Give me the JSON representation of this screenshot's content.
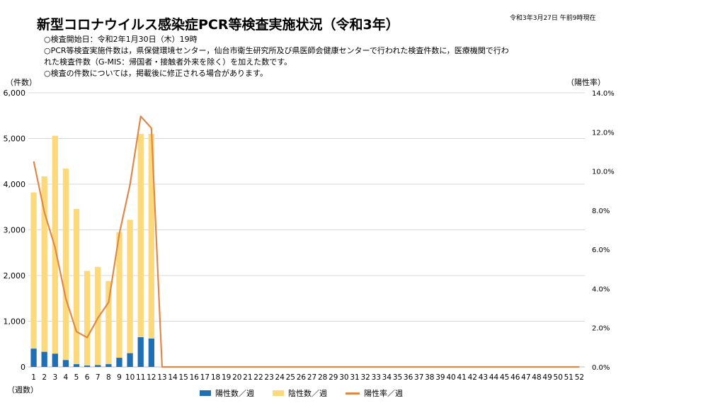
{
  "title": "新型コロナウイルス感染症PCR等検査実施状況（令和3年）",
  "as_of": "令和3年3月27日 午前9時現在",
  "notes": [
    "○検査開始日：令和2年1月30日（木）19時",
    "○PCR等検査実施件数は，県保健環境センター，仙台市衛生研究所及び県医師会健康センターで行われた検査件数に，医療機関で行わ",
    "れた検査件数（G-MIS：帰国者・接触者外来を除く）を加えた数です。",
    "○検査の件数については，掲載後に修正される場合があります。"
  ],
  "colors": {
    "positive": "#1f6fb5",
    "negative": "#fcd97a",
    "rate": "#e08848"
  },
  "chart_data": {
    "type": "bar",
    "ylabel": "（件数）",
    "y2label": "（陽性率）",
    "xlabel": "（週数）",
    "ylim": [
      0,
      6000
    ],
    "y2lim": [
      0,
      14
    ],
    "yticks": [
      "0",
      "1,000",
      "2,000",
      "3,000",
      "4,000",
      "5,000",
      "6,000"
    ],
    "y2ticks": [
      "0.0%",
      "2.0%",
      "4.0%",
      "6.0%",
      "8.0%",
      "10.0%",
      "12.0%",
      "14.0%"
    ],
    "categories": [
      "1",
      "2",
      "3",
      "4",
      "5",
      "6",
      "7",
      "8",
      "9",
      "10",
      "11",
      "12",
      "13",
      "14",
      "15",
      "16",
      "17",
      "18",
      "19",
      "20",
      "21",
      "22",
      "23",
      "24",
      "25",
      "26",
      "27",
      "28",
      "29",
      "30",
      "31",
      "32",
      "33",
      "34",
      "35",
      "36",
      "37",
      "38",
      "39",
      "40",
      "41",
      "42",
      "43",
      "44",
      "45",
      "46",
      "47",
      "48",
      "49",
      "50",
      "51",
      "52"
    ],
    "series": [
      {
        "name": "陽性数／週",
        "kind": "bar-stack",
        "values": [
          400,
          330,
          290,
          150,
          60,
          30,
          40,
          60,
          200,
          300,
          650,
          620
        ]
      },
      {
        "name": "陰性数／週",
        "kind": "bar-stack",
        "values": [
          3420,
          3840,
          4770,
          4190,
          3400,
          2070,
          2150,
          1820,
          2750,
          2920,
          4450,
          4480
        ]
      },
      {
        "name": "陽性率／週",
        "kind": "line-secondary",
        "values": [
          10.5,
          7.9,
          6.1,
          3.5,
          1.8,
          1.5,
          2.5,
          3.3,
          6.8,
          9.3,
          12.8,
          12.2,
          0,
          0,
          0,
          0,
          0,
          0,
          0,
          0,
          0,
          0,
          0,
          0,
          0,
          0,
          0,
          0,
          0,
          0,
          0,
          0,
          0,
          0,
          0,
          0,
          0,
          0,
          0,
          0,
          0,
          0,
          0,
          0,
          0,
          0,
          0,
          0,
          0,
          0,
          0,
          0
        ]
      }
    ],
    "grid": true,
    "legend": "bottom"
  }
}
